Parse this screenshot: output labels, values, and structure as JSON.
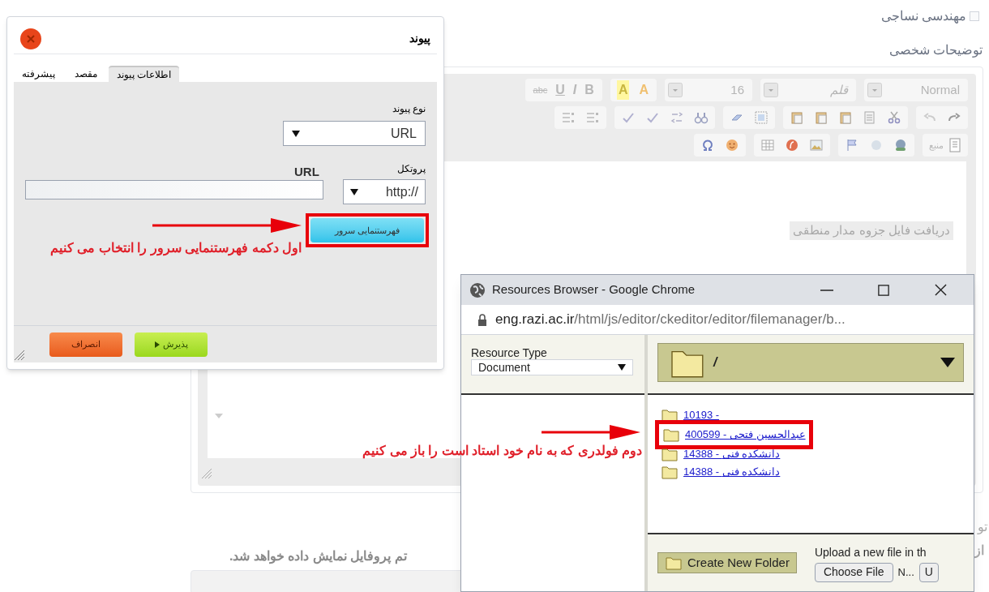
{
  "page": {
    "checkbox_label": "مهندسی نساجی",
    "checked": false,
    "section_label": "توضیحات شخصی",
    "editor": {
      "format_value": "Normal",
      "font_value": "قلم",
      "size_value": "16",
      "color_buttons": [
        "A",
        "A"
      ],
      "style_buttons": [
        "B",
        "I",
        "U",
        "abc"
      ],
      "source_button": "منبع",
      "content": "دریافت فایل جزوه مدار منطقی"
    },
    "note": "تم پروفایل نمایش داده خواهد شد.",
    "side_fragments": [
      "تو",
      "از"
    ]
  },
  "link_dialog": {
    "title": "پیوند",
    "tabs": [
      {
        "label": "اطلاعات پیوند",
        "selected": true
      },
      {
        "label": "مقصد",
        "selected": false
      },
      {
        "label": "پیشرفته",
        "selected": false
      }
    ],
    "link_type_label": "نوع پیوند",
    "link_type_value": "URL",
    "protocol_label": "پروتکل",
    "protocol_value": "http://",
    "url_label": "URL",
    "browse_server_button": "فهرستنمایی سرور",
    "ok_button": "پذیرش",
    "cancel_button": "انصراف"
  },
  "annotations": [
    {
      "text": "اول دکمه فهرستنمایی سرور را انتخاب می کنیم"
    },
    {
      "text": "دوم فولدری که به نام خود استاد است را باز می کنیم"
    }
  ],
  "browser_window": {
    "title": "Resources Browser - Google Chrome",
    "url_host": "eng.razi.ac.ir",
    "url_path": "/html/js/editor/ckeditor/editor/filemanager/b...",
    "resource_type_label": "Resource Type",
    "resource_type_value": "Document",
    "current_folder": "/",
    "folders": [
      {
        "name": "10193 -",
        "selected": false
      },
      {
        "name": "400599 - عبدالحسین فتحی",
        "selected": true
      },
      {
        "name": "14388 - دانشکده فنی",
        "selected": false
      },
      {
        "name": "14388 - دانشکده فنی",
        "selected": false
      }
    ],
    "create_folder_button": "Create New Folder",
    "upload_label": "Upload a new file in th",
    "choose_file_button": "Choose File",
    "file_status": "N...",
    "upload_button": "U"
  }
}
